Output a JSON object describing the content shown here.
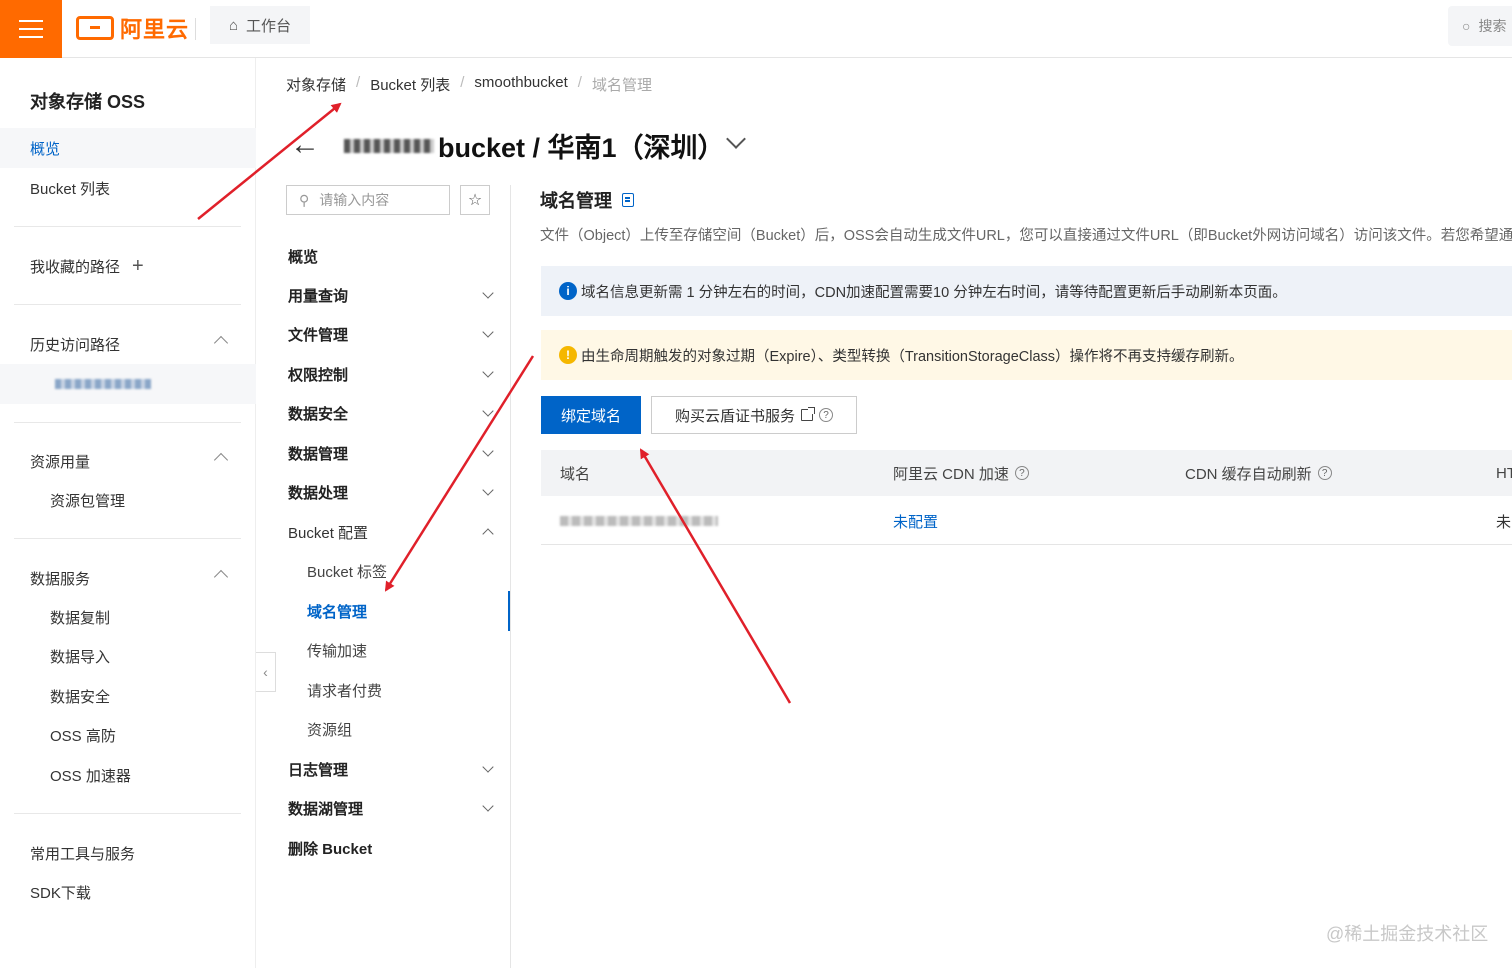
{
  "topbar": {
    "logo_text": "阿里云",
    "workbench_label": "工作台",
    "search_placeholder": "搜索"
  },
  "leftnav": {
    "title": "对象存储 OSS",
    "overview": "概览",
    "bucket_list": "Bucket 列表",
    "favorites": "我收藏的路径",
    "history": "历史访问路径",
    "resource_usage": "资源用量",
    "resource_pkg": "资源包管理",
    "data_service": "数据服务",
    "data_service_items": [
      "数据复制",
      "数据导入",
      "数据安全",
      "OSS 高防",
      "OSS 加速器"
    ],
    "tools": "常用工具与服务",
    "sdk": "SDK下载"
  },
  "breadcrumb": [
    "对象存储",
    "Bucket 列表",
    "smoothbucket",
    "域名管理"
  ],
  "header": {
    "bucket_suffix": "bucket / 华南1（深圳）"
  },
  "midmenu": {
    "search_placeholder": "请输入内容",
    "items": [
      {
        "label": "概览"
      },
      {
        "label": "用量查询"
      },
      {
        "label": "文件管理"
      },
      {
        "label": "权限控制"
      },
      {
        "label": "数据安全"
      },
      {
        "label": "数据管理"
      },
      {
        "label": "数据处理"
      },
      {
        "label": "Bucket 配置"
      },
      {
        "label": "Bucket 标签"
      },
      {
        "label": "域名管理"
      },
      {
        "label": "传输加速"
      },
      {
        "label": "请求者付费"
      },
      {
        "label": "资源组"
      },
      {
        "label": "日志管理"
      },
      {
        "label": "数据湖管理"
      },
      {
        "label": "删除 Bucket"
      }
    ]
  },
  "content": {
    "title": "域名管理",
    "description": "文件（Object）上传至存储空间（Bucket）后，OSS会自动生成文件URL，您可以直接通过文件URL（即Bucket外网访问域名）访问该文件。若您希望通",
    "info_alert": "域名信息更新需 1 分钟左右的时间，CDN加速配置需要10 分钟左右时间，请等待配置更新后手动刷新本页面。",
    "warn_alert": "由生命周期触发的对象过期（Expire）、类型转换（TransitionStorageClass）操作将不再支持缓存刷新。",
    "bind_button": "绑定域名",
    "buy_button": "购买云盾证书服务",
    "table": {
      "headers": [
        "域名",
        "阿里云 CDN 加速",
        "CDN 缓存自动刷新",
        "HT"
      ],
      "rows": [
        {
          "cdn": "未配置",
          "refresh_trunc": "未"
        }
      ]
    }
  },
  "watermark": "@稀土掘金技术社区",
  "colors": {
    "brand": "#ff6a00",
    "primary": "#0064c8",
    "annotation": "#e0202a"
  }
}
